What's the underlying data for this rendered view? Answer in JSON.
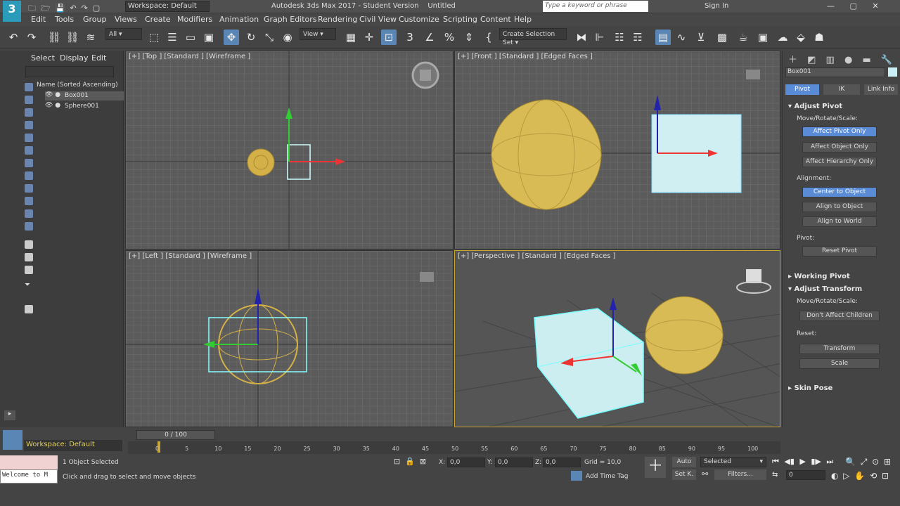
{
  "titlebar": {
    "workspace": "Workspace: Default",
    "title": "Autodesk 3ds Max 2017 - Student Version",
    "doc": "Untitled",
    "search_placeholder": "Type a keyword or phrase",
    "sign_in": "Sign In"
  },
  "menu": [
    "Edit",
    "Tools",
    "Group",
    "Views",
    "Create",
    "Modifiers",
    "Animation",
    "Graph Editors",
    "Rendering",
    "Civil View",
    "Customize",
    "Scripting",
    "Content",
    "Help"
  ],
  "toolbar": {
    "filter": "All",
    "view": "View",
    "selection_set": "Create Selection Set"
  },
  "scene_explorer": {
    "tabs": [
      "Select",
      "Display",
      "Edit"
    ],
    "column": "Name (Sorted Ascending)",
    "items": [
      "Box001",
      "Sphere001"
    ]
  },
  "viewports": {
    "top": "[+] [Top ] [Standard ] [Wireframe ]",
    "front": "[+] [Front ] [Standard ] [Edged Faces ]",
    "left": "[+] [Left ] [Standard ] [Wireframe ]",
    "persp": "[+] [Perspective ] [Standard ] [Edged Faces ]"
  },
  "cmd_panel": {
    "object_name": "Box001",
    "tabs": [
      "Pivot",
      "IK",
      "Link Info"
    ],
    "adjust_pivot": "Adjust Pivot",
    "move_rotate_scale": "Move/Rotate/Scale:",
    "affect_pivot": "Affect Pivot Only",
    "affect_object": "Affect Object Only",
    "affect_hierarchy": "Affect Hierarchy Only",
    "alignment": "Alignment:",
    "center_to_object": "Center to Object",
    "align_to_object": "Align to Object",
    "align_to_world": "Align to World",
    "pivot": "Pivot:",
    "reset_pivot": "Reset Pivot",
    "working_pivot": "Working Pivot",
    "adjust_transform": "Adjust Transform",
    "mrs2": "Move/Rotate/Scale:",
    "dont_affect": "Don't Affect Children",
    "reset": "Reset:",
    "transform": "Transform",
    "scale": "Scale",
    "skin_pose": "Skin Pose"
  },
  "timeline": {
    "frame": "0 / 100",
    "ticks": [
      "0",
      "5",
      "10",
      "15",
      "20",
      "25",
      "30",
      "35",
      "40",
      "45",
      "50",
      "55",
      "60",
      "65",
      "70",
      "75",
      "80",
      "85",
      "90",
      "95",
      "100"
    ]
  },
  "status": {
    "workspace": "Workspace: Default",
    "selected": "1 Object Selected",
    "hint": "Click and drag to select and move objects",
    "welcome": "Welcome to M",
    "x_label": "X:",
    "x": "0,0",
    "y_label": "Y:",
    "y": "0,0",
    "z_label": "Z:",
    "z": "0,0",
    "grid": "Grid = 10,0",
    "add_time_tag": "Add Time Tag",
    "auto": "Auto",
    "set_key": "Set K.",
    "selected_dd": "Selected",
    "filters": "Filters...",
    "frame_field": "0"
  }
}
